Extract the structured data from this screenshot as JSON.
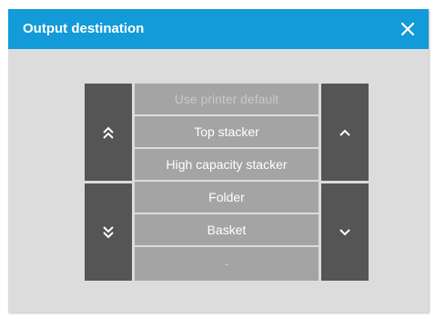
{
  "dialog": {
    "title": "Output destination",
    "close_icon": "close-icon",
    "accent_color": "#139ad8"
  },
  "selector": {
    "page_up_icon": "double-chevron-up-icon",
    "page_down_icon": "double-chevron-down-icon",
    "up_icon": "chevron-up-icon",
    "down_icon": "chevron-down-icon",
    "items": [
      {
        "label": "Use printer default",
        "enabled": false
      },
      {
        "label": "Top stacker",
        "enabled": true
      },
      {
        "label": "High capacity stacker",
        "enabled": true
      },
      {
        "label": "Folder",
        "enabled": true
      },
      {
        "label": "Basket",
        "enabled": true
      },
      {
        "label": "-",
        "enabled": false
      }
    ]
  }
}
